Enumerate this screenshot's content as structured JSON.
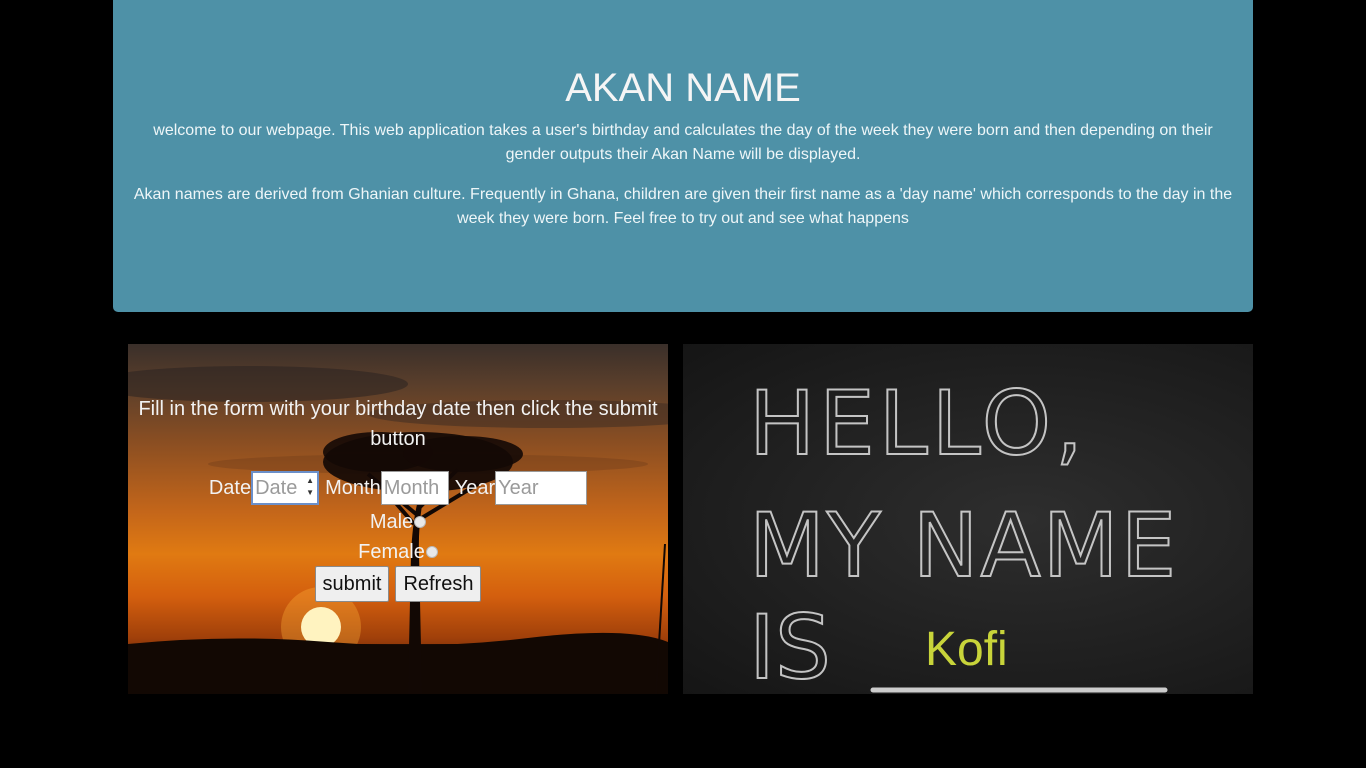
{
  "header": {
    "title": "AKAN NAME",
    "intro": "welcome to our webpage. This web application takes a user's birthday and calculates the day of the week they were born and then depending on their gender outputs their Akan Name will be displayed.",
    "description": "Akan names are derived from Ghanian culture. Frequently in Ghana, children are given their first name as a 'day name' which corresponds to the day in the week they were born. Feel free to try out and see what happens"
  },
  "form": {
    "instruction": "Fill in the form with your birthday date then click the submit button",
    "date_label": "Date",
    "date_placeholder": "Date",
    "month_label": "Month",
    "month_placeholder": "Month",
    "year_label": "Year",
    "year_placeholder": "Year",
    "male_label": "Male",
    "female_label": "Female",
    "submit_label": "submit",
    "refresh_label": "Refresh"
  },
  "result": {
    "chalk_line1": "HELLO,",
    "chalk_line2": "MY NAME",
    "chalk_line3": "IS",
    "akan_name": "Kofi"
  },
  "colors": {
    "jumbotron": "#4e91a7",
    "background": "#000000",
    "result_text": "#c8d43a"
  }
}
